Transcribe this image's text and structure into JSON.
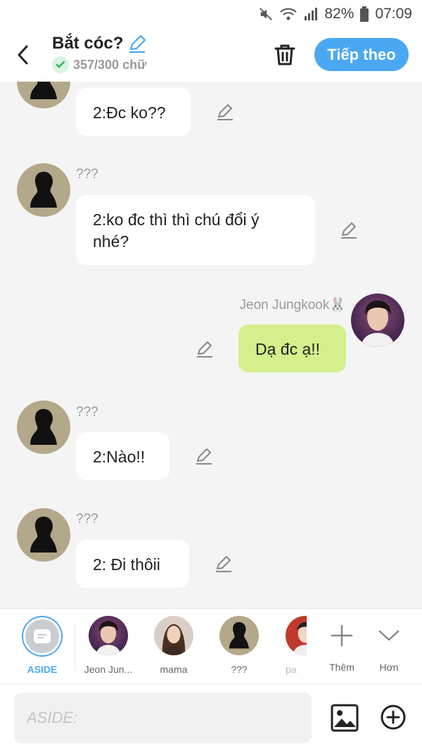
{
  "status_bar": {
    "battery": "82%",
    "time": "07:09"
  },
  "header": {
    "title": "Bắt cóc?",
    "word_count": "357/300 chữ",
    "next_label": "Tiếp theo"
  },
  "messages": [
    {
      "sender": "",
      "text": "2:Đc ko??"
    },
    {
      "sender": "???",
      "text": "2:ko đc thì thì chú đổi ý nhé?"
    },
    {
      "sender": "Jeon Jungkook🐰",
      "text": "Dạ đc ạ!!"
    },
    {
      "sender": "???",
      "text": "2:Nào!!"
    },
    {
      "sender": "???",
      "text": "2: Đi thôii"
    }
  ],
  "characters": [
    {
      "label": "ASIDE"
    },
    {
      "label": "Jeon Jun..."
    },
    {
      "label": "mama"
    },
    {
      "label": "???"
    },
    {
      "label": "pa"
    }
  ],
  "actions": {
    "more_label": "Thêm",
    "less_label": "Hơn"
  },
  "input": {
    "placeholder": "ASIDE:"
  },
  "colors": {
    "accent": "#4aa8f2",
    "mine_bubble": "#d3f08c",
    "bubble": "#ffffff",
    "background": "#f4f4f4"
  }
}
